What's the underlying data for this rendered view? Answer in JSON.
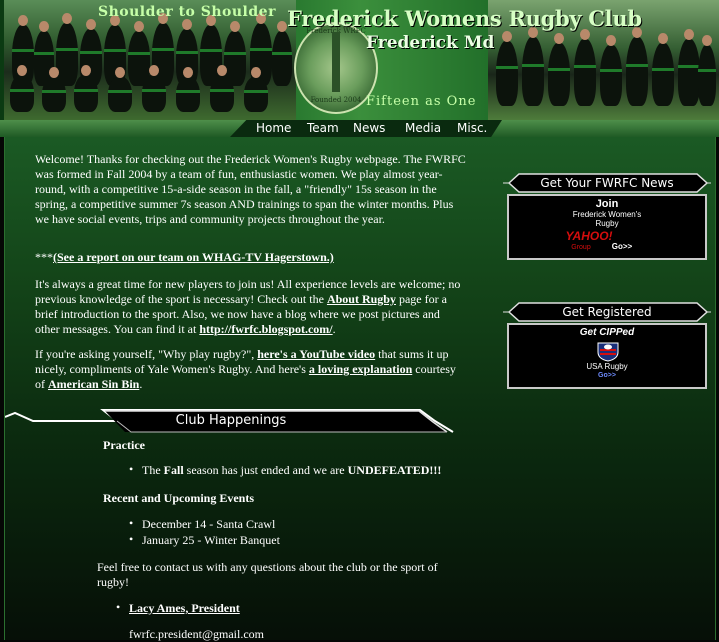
{
  "header": {
    "slogan": "Shoulder to Shoulder",
    "club_title": "Frederick Womens Rugby Club",
    "city": "Frederick Md",
    "motto": "Fifteen as One",
    "seal_text": "Frederick WRFC",
    "seal_year": "Founded 2004"
  },
  "nav": {
    "items": [
      "Home",
      "Team",
      "News",
      "Media",
      "Misc."
    ]
  },
  "main": {
    "p1": "Welcome! Thanks for checking out the Frederick Women's Rugby webpage. The FWRFC was formed in Fall 2004 by a team of fun, enthusiastic women. We play almost year-round, with a competitive 15-a-side season in the fall, a \"friendly\" 15s season in the spring, a competitive summer 7s season AND trainings to span the winter months. Plus we have social events, trips and community projects throughout the year.",
    "p2_prefix": "***",
    "p2_link": "(See a report on our team on WHAG-TV Hagerstown.)",
    "p3_a": "It's always a great time for new players to join us! All experience levels are welcome; no previous knowledge of the sport is necessary! Check out the ",
    "p3_link1": "About Rugby",
    "p3_b": " page for a brief introduction to the sport. Also, we now have a blog where we post pictures and other messages. You can find it at ",
    "p3_link2": "http://fwrfc.blogspot.com/",
    "p3_c": ".",
    "p4_a": "If you're asking yourself, \"Why play rugby?\", ",
    "p4_link1": "here's a YouTube video",
    "p4_b": " that sums it up nicely, compliments of Yale Women's Rugby. And here's ",
    "p4_link2": "a loving explanation",
    "p4_c": " courtesy of ",
    "p4_link3": "American Sin Bin",
    "p4_d": "."
  },
  "happenings": {
    "title": "Club Happenings",
    "practice_heading": "Practice",
    "practice_item_a": "The ",
    "practice_item_fall": "Fall",
    "practice_item_b": " season has just ended and we are ",
    "practice_item_undefeated": "UNDEFEATED!!!",
    "events_heading": "Recent and Upcoming Events",
    "events": [
      "December 14 - Santa Crawl",
      "January 25 - Winter Banquet"
    ],
    "contact_text": "Feel free to contact us with any questions about the club or the sport of rugby!",
    "president_link": "Lacy Ames, President",
    "president_email": "fwrfc.president@gmail.com"
  },
  "sidebar": {
    "news_box": {
      "title": "Get Your FWRFC News",
      "join": "Join",
      "group_name": "Frederick Women's Rugby",
      "logo": "YAHOO!",
      "group_label": "Group",
      "go": "Go>>"
    },
    "register_box": {
      "title": "Get Registered",
      "subtitle": "Get CIPPed",
      "org": "USA Rugby",
      "go": "Go>>"
    }
  },
  "colors": {
    "brand_green": "#1d6a27",
    "light_green": "#c6ffa8",
    "yahoo_red": "#d50d0d"
  }
}
